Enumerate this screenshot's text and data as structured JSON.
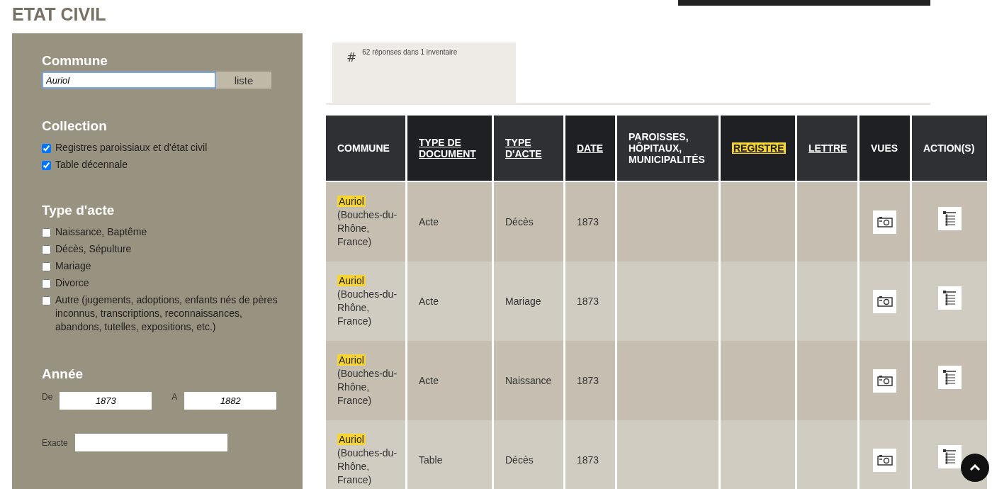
{
  "page_title": "ETAT CIVIL",
  "filters": {
    "commune": {
      "heading": "Commune",
      "value": "Auriol",
      "button": "liste"
    },
    "collection": {
      "heading": "Collection",
      "options": [
        {
          "label": "Registres paroissiaux et d'état civil",
          "checked": true
        },
        {
          "label": "Table décennale",
          "checked": true
        }
      ]
    },
    "type_acte": {
      "heading": "Type d'acte",
      "options": [
        {
          "label": "Naissance, Baptême",
          "checked": false
        },
        {
          "label": "Décès, Sépulture",
          "checked": false
        },
        {
          "label": "Mariage",
          "checked": false
        },
        {
          "label": "Divorce",
          "checked": false
        },
        {
          "label": "Autre (jugements, adoptions, enfants nés de pères inconnus, transcriptions, reconnaissances, abandons, tutelles, expositions, etc.)",
          "checked": false
        }
      ]
    },
    "annee": {
      "heading": "Année",
      "from_label": "De",
      "from_value": "1873",
      "to_label": "A",
      "to_value": "1882",
      "exact_label": "Exacte"
    }
  },
  "results": {
    "icon": "#",
    "summary": "62 réponses dans 1 inventaire"
  },
  "table": {
    "columns": [
      {
        "label": "COMMUNE",
        "sortable": false,
        "highlighted": false
      },
      {
        "label": "TYPE DE DOCUMENT",
        "sortable": true,
        "highlighted": false
      },
      {
        "label": "TYPE D'ACTE",
        "sortable": true,
        "highlighted": false
      },
      {
        "label": "DATE",
        "sortable": true,
        "highlighted": false
      },
      {
        "label": "PAROISSES, HÔPITAUX, MUNICIPALITÉS",
        "sortable": false,
        "highlighted": false
      },
      {
        "label": "REGISTRE",
        "sortable": true,
        "highlighted": true
      },
      {
        "label": "LETTRE",
        "sortable": true,
        "highlighted": false
      },
      {
        "label": "VUES",
        "sortable": false,
        "highlighted": false
      },
      {
        "label": "ACTION(S)",
        "sortable": false,
        "highlighted": false
      }
    ],
    "rows": [
      {
        "commune": "Auriol",
        "region": "(Bouches-du-Rhône, France)",
        "type_document": "Acte",
        "type_acte": "Décès",
        "date": "1873"
      },
      {
        "commune": "Auriol",
        "region": "(Bouches-du-Rhône, France)",
        "type_document": "Acte",
        "type_acte": "Mariage",
        "date": "1873"
      },
      {
        "commune": "Auriol",
        "region": "(Bouches-du-Rhône, France)",
        "type_document": "Acte",
        "type_acte": "Naissance",
        "date": "1873"
      },
      {
        "commune": "Auriol",
        "region": "(Bouches-du-Rhône, France)",
        "type_document": "Table",
        "type_acte": "Décès",
        "date": "1873"
      }
    ]
  }
}
